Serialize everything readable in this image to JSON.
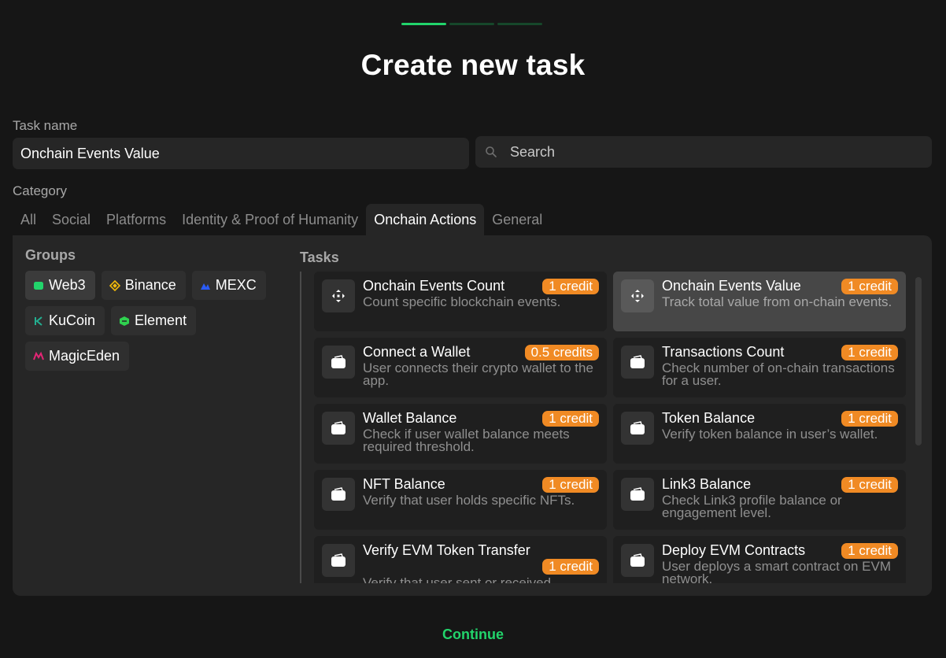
{
  "title": "Create new task",
  "progress_steps": 3,
  "progress_current": 1,
  "task_name": {
    "label": "Task name",
    "value": "Onchain Events Value"
  },
  "search": {
    "placeholder": "Search"
  },
  "category": {
    "label": "Category",
    "tabs": [
      "All",
      "Social",
      "Platforms",
      "Identity & Proof of Humanity",
      "Onchain Actions",
      "General"
    ],
    "active": "Onchain Actions"
  },
  "groups": {
    "title": "Groups",
    "items": [
      {
        "label": "Web3",
        "icon": "web3-icon",
        "color": "#22d46b",
        "active": true
      },
      {
        "label": "Binance",
        "icon": "binance-icon",
        "color": "#f0b90b",
        "active": false
      },
      {
        "label": "MEXC",
        "icon": "mexc-icon",
        "color": "#2a5bf5",
        "active": false
      },
      {
        "label": "KuCoin",
        "icon": "kucoin-icon",
        "color": "#23af91",
        "active": false
      },
      {
        "label": "Element",
        "icon": "element-icon",
        "color": "#2fd14f",
        "active": false
      },
      {
        "label": "MagicEden",
        "icon": "magiceden-icon",
        "color": "#e42575",
        "active": false
      }
    ]
  },
  "tasks": {
    "title": "Tasks",
    "items": [
      {
        "name": "Onchain Events Count",
        "credit": "1 credit",
        "desc": "Count specific blockchain events.",
        "icon": "move-arrows-icon",
        "selected": false
      },
      {
        "name": "Onchain Events Value",
        "credit": "1 credit",
        "desc": "Track total value from on-chain events.",
        "icon": "move-arrows-icon",
        "selected": true
      },
      {
        "name": "Connect a Wallet",
        "credit": "0.5 credits",
        "desc": "User connects their crypto wallet to the app.",
        "icon": "wallet-icon",
        "selected": false
      },
      {
        "name": "Transactions Count",
        "credit": "1 credit",
        "desc": "Check number of on-chain transactions for a user.",
        "icon": "wallet-icon",
        "selected": false
      },
      {
        "name": "Wallet Balance",
        "credit": "1 credit",
        "desc": "Check if user wallet balance meets required threshold.",
        "icon": "wallet-icon",
        "selected": false
      },
      {
        "name": "Token Balance",
        "credit": "1 credit",
        "desc": "Verify token balance in user’s wallet.",
        "icon": "wallet-icon",
        "selected": false
      },
      {
        "name": "NFT Balance",
        "credit": "1 credit",
        "desc": "Verify that user holds specific NFTs.",
        "icon": "wallet-icon",
        "selected": false
      },
      {
        "name": "Link3 Balance",
        "credit": "1 credit",
        "desc": "Check Link3 profile balance or engagement level.",
        "icon": "wallet-icon",
        "selected": false
      },
      {
        "name": "Verify EVM Token Transfer",
        "credit": "1 credit",
        "desc": "Verify that user sent or received",
        "icon": "wallet-icon",
        "selected": false,
        "badge_low": true
      },
      {
        "name": "Deploy EVM Contracts",
        "credit": "1 credit",
        "desc": "User deploys a smart contract on EVM network.",
        "icon": "wallet-icon",
        "selected": false
      }
    ]
  },
  "continue_label": "Continue",
  "colors": {
    "accent": "#22d46b",
    "credit_badge": "#f08a24",
    "background": "#161616",
    "panel": "#262626"
  }
}
